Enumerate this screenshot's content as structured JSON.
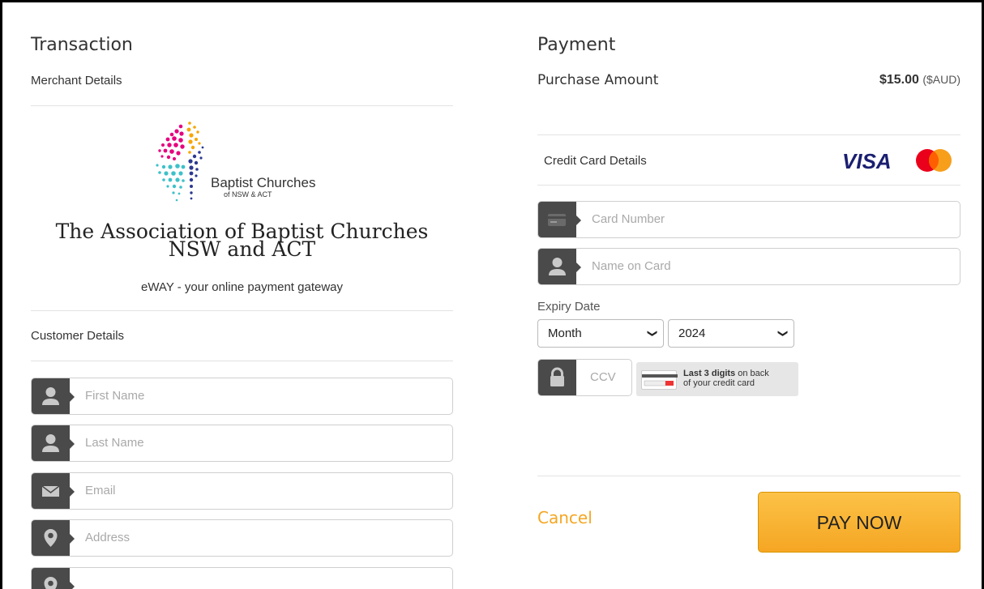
{
  "transaction": {
    "title": "Transaction",
    "merchant_details_label": "Merchant Details",
    "logo_line1": "Baptist Churches",
    "logo_line2": "of NSW & ACT",
    "merchant_name_line1": "The Association of Baptist Churches",
    "merchant_name_line2": "NSW and ACT",
    "gateway_text": "eWAY - your online payment gateway",
    "customer_details_label": "Customer Details",
    "fields": {
      "first_name": {
        "placeholder": "First Name",
        "icon": "person-icon"
      },
      "last_name": {
        "placeholder": "Last Name",
        "icon": "person-icon"
      },
      "email": {
        "placeholder": "Email",
        "icon": "envelope-icon"
      },
      "address": {
        "placeholder": "Address",
        "icon": "map-pin-icon"
      },
      "address2": {
        "placeholder": "",
        "icon": "map-pin-icon"
      }
    }
  },
  "payment": {
    "title": "Payment",
    "purchase_amount_label": "Purchase Amount",
    "amount": "$15.00",
    "currency": "($AUD)",
    "credit_card_label": "Credit Card Details",
    "visa_label": "VISA",
    "card_number_placeholder": "Card Number",
    "name_on_card_placeholder": "Name on Card",
    "expiry_label": "Expiry Date",
    "month_value": "Month",
    "year_value": "2024",
    "ccv_placeholder": "CCV",
    "ccv_hint_bold": "Last 3 digits",
    "ccv_hint_rest": " on back",
    "ccv_hint_line2": "of your credit card",
    "cancel_label": "Cancel",
    "pay_now_label": "PAY NOW"
  },
  "colors": {
    "accent": "#f5a623",
    "addon": "#4a4a4a",
    "visa": "#1a1f71"
  }
}
